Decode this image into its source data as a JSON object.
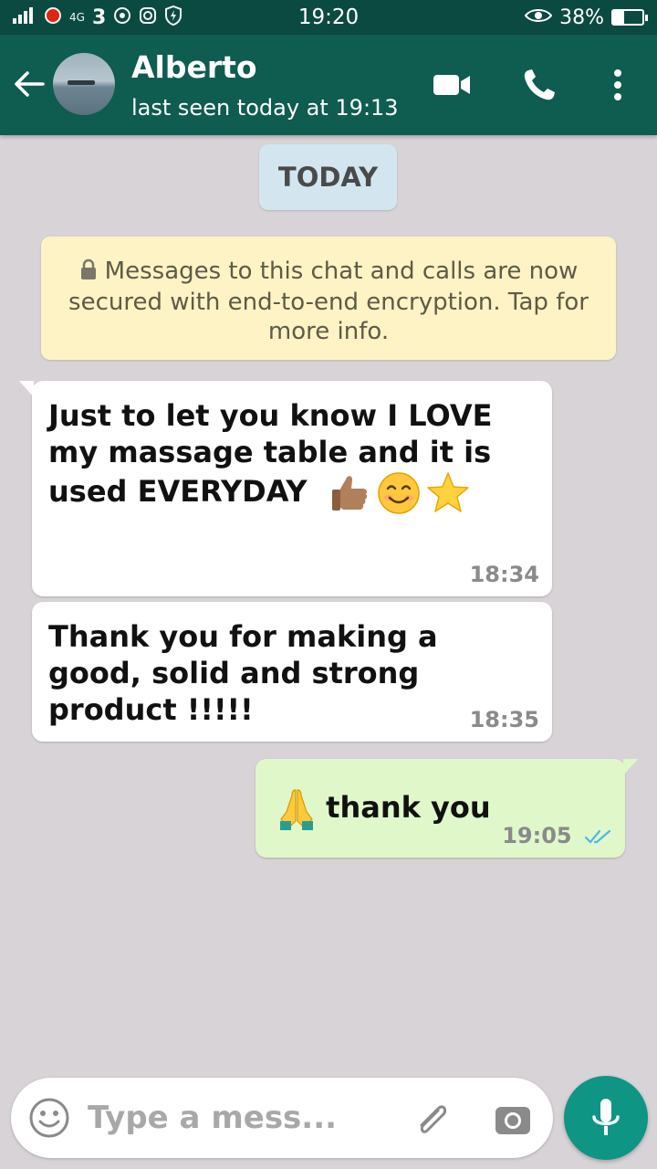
{
  "status_bar": {
    "time": "19:20",
    "network_label": "4G",
    "battery_text": "38%",
    "battery_level": 0.38
  },
  "header": {
    "contact_name": "Alberto",
    "last_seen": "last seen today at 19:13"
  },
  "chat": {
    "date_chip": "TODAY",
    "system_note": "Messages to this chat and calls are now secured with end-to-end encryption. Tap for more info.",
    "messages": [
      {
        "direction": "incoming",
        "text": "Just to let you know I LOVE my massage table and it is used EVERYDAY",
        "emojis": [
          "thumbs-up",
          "smiling-face",
          "star"
        ],
        "time": "18:34"
      },
      {
        "direction": "incoming",
        "text": "Thank you for making a good, solid and strong product !!!!!",
        "time": "18:35"
      },
      {
        "direction": "outgoing",
        "emojis": [
          "folded-hands"
        ],
        "text": "thank you",
        "time": "19:05",
        "status": "read"
      }
    ]
  },
  "composer": {
    "placeholder": "Type a mess..."
  },
  "colors": {
    "header": "#0f5c50",
    "status_bar": "#0b4a40",
    "chat_background": "#d8d3d6",
    "outgoing_bubble": "#e0f8c9",
    "incoming_bubble": "#ffffff",
    "mic_button": "#0e9584",
    "read_ticks": "#4fb6ec"
  }
}
